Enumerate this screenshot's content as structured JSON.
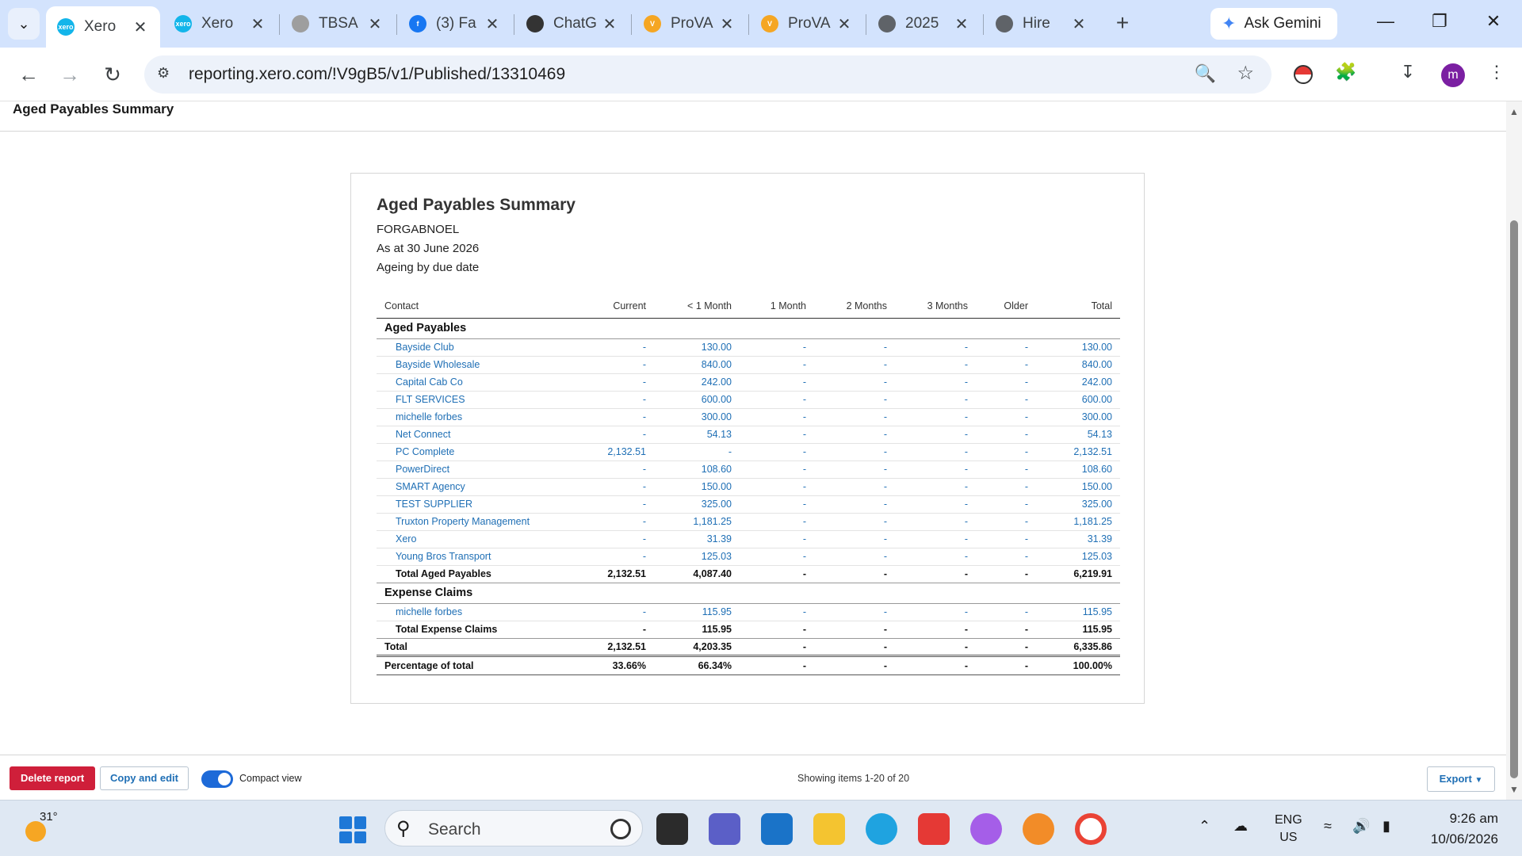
{
  "browser": {
    "tabs": [
      {
        "title": "Xero",
        "active": true,
        "favicon_color": "#13b5ea",
        "favicon_text": "xero"
      },
      {
        "title": "Xero",
        "active": false,
        "favicon_color": "#13b5ea",
        "favicon_text": "xero"
      },
      {
        "title": "TBSA",
        "active": false,
        "favicon_color": "#9e9e9e",
        "favicon_text": ""
      },
      {
        "title": "(3) Fa",
        "active": false,
        "favicon_color": "#1877f2",
        "favicon_text": "f"
      },
      {
        "title": "ChatG",
        "active": false,
        "favicon_color": "#333333",
        "favicon_text": ""
      },
      {
        "title": "ProVA",
        "active": false,
        "favicon_color": "#f5a623",
        "favicon_text": "V"
      },
      {
        "title": "ProVA",
        "active": false,
        "favicon_color": "#f5a623",
        "favicon_text": "V"
      },
      {
        "title": "2025",
        "active": false,
        "favicon_color": "#5f6368",
        "favicon_text": ""
      },
      {
        "title": "Hire",
        "active": false,
        "favicon_color": "#5f6368",
        "favicon_text": ""
      }
    ],
    "ask_gemini_label": "Ask Gemini",
    "url": "reporting.xero.com/!V9gB5/v1/Published/13310469",
    "avatar_letter": "m"
  },
  "page": {
    "header_title": "Aged Payables Summary",
    "report": {
      "title": "Aged Payables Summary",
      "organisation": "FORGABNOEL",
      "as_at": "As at 30 June 2026",
      "ageing": "Ageing by due date",
      "columns": [
        "Contact",
        "Current",
        "< 1 Month",
        "1 Month",
        "2 Months",
        "3 Months",
        "Older",
        "Total"
      ],
      "sections": [
        {
          "name": "Aged Payables",
          "rows": [
            {
              "contact": "Bayside Club",
              "values": [
                "-",
                "130.00",
                "-",
                "-",
                "-",
                "-",
                "130.00"
              ]
            },
            {
              "contact": "Bayside Wholesale",
              "values": [
                "-",
                "840.00",
                "-",
                "-",
                "-",
                "-",
                "840.00"
              ]
            },
            {
              "contact": "Capital Cab Co",
              "values": [
                "-",
                "242.00",
                "-",
                "-",
                "-",
                "-",
                "242.00"
              ]
            },
            {
              "contact": "FLT SERVICES",
              "values": [
                "-",
                "600.00",
                "-",
                "-",
                "-",
                "-",
                "600.00"
              ]
            },
            {
              "contact": "michelle forbes",
              "values": [
                "-",
                "300.00",
                "-",
                "-",
                "-",
                "-",
                "300.00"
              ]
            },
            {
              "contact": "Net Connect",
              "values": [
                "-",
                "54.13",
                "-",
                "-",
                "-",
                "-",
                "54.13"
              ]
            },
            {
              "contact": "PC Complete",
              "values": [
                "2,132.51",
                "-",
                "-",
                "-",
                "-",
                "-",
                "2,132.51"
              ]
            },
            {
              "contact": "PowerDirect",
              "values": [
                "-",
                "108.60",
                "-",
                "-",
                "-",
                "-",
                "108.60"
              ]
            },
            {
              "contact": "SMART Agency",
              "values": [
                "-",
                "150.00",
                "-",
                "-",
                "-",
                "-",
                "150.00"
              ]
            },
            {
              "contact": "TEST SUPPLIER",
              "values": [
                "-",
                "325.00",
                "-",
                "-",
                "-",
                "-",
                "325.00"
              ]
            },
            {
              "contact": "Truxton Property Management",
              "values": [
                "-",
                "1,181.25",
                "-",
                "-",
                "-",
                "-",
                "1,181.25"
              ]
            },
            {
              "contact": "Xero",
              "values": [
                "-",
                "31.39",
                "-",
                "-",
                "-",
                "-",
                "31.39"
              ]
            },
            {
              "contact": "Young Bros Transport",
              "values": [
                "-",
                "125.03",
                "-",
                "-",
                "-",
                "-",
                "125.03"
              ]
            }
          ],
          "total": {
            "label": "Total Aged Payables",
            "values": [
              "2,132.51",
              "4,087.40",
              "-",
              "-",
              "-",
              "-",
              "6,219.91"
            ]
          }
        },
        {
          "name": "Expense Claims",
          "rows": [
            {
              "contact": "michelle forbes",
              "values": [
                "-",
                "115.95",
                "-",
                "-",
                "-",
                "-",
                "115.95"
              ]
            }
          ],
          "total": {
            "label": "Total Expense Claims",
            "values": [
              "-",
              "115.95",
              "-",
              "-",
              "-",
              "-",
              "115.95"
            ]
          }
        }
      ],
      "grand_total": {
        "label": "Total",
        "values": [
          "2,132.51",
          "4,203.35",
          "-",
          "-",
          "-",
          "-",
          "6,335.86"
        ]
      },
      "percentage": {
        "label": "Percentage of total",
        "values": [
          "33.66%",
          "66.34%",
          "-",
          "-",
          "-",
          "-",
          "100.00%"
        ]
      }
    }
  },
  "footer": {
    "delete_label": "Delete report",
    "copy_label": "Copy and edit",
    "compact_label": "Compact view",
    "compact_on": true,
    "showing_label": "Showing items 1-20 of 20",
    "export_label": "Export"
  },
  "taskbar": {
    "temperature": "31°",
    "search_label": "Search",
    "language": "ENG",
    "region": "US",
    "time": "9:26 am",
    "date": "10/06/2026"
  },
  "colors": {
    "link_blue": "#1f6fb5",
    "delete_red": "#cf1f3a",
    "toggle_blue": "#1d6ad8",
    "tabstrip": "#d3e3fd"
  }
}
